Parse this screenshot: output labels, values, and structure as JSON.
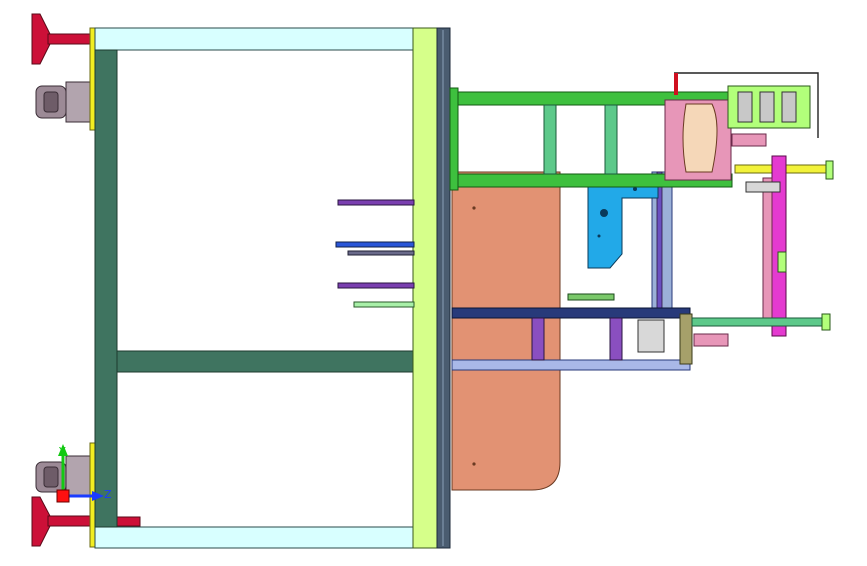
{
  "viewport": {
    "background": "#ffffff",
    "triad": {
      "y_label": "Y",
      "z_label": "Z",
      "y_color": "#13c913",
      "z_color": "#1a3cff",
      "x_color": "#ff1010"
    }
  },
  "colors": {
    "frame_fill": "#d8ffff",
    "frame_post": "#3f7460",
    "frame_plate": "#d6ff8a",
    "frame_yellow": "#f2ee22",
    "foot": "#cc1038",
    "caster": "#9c8a96",
    "panel_orange": "#e29273",
    "arm_green": "#3ec03e",
    "rod_green": "#5dc98a",
    "bracket_blue": "#22a9e8",
    "slide_navy": "#283a7a",
    "slide_light": "#a9b8e8",
    "purple": "#8a4fc0",
    "magenta": "#e43ad0",
    "pink": "#e796b8",
    "cylinder_yellow": "#f2f23a",
    "cylinder_green": "#b2ff7a",
    "dark_edge": "#3a4a5c"
  }
}
